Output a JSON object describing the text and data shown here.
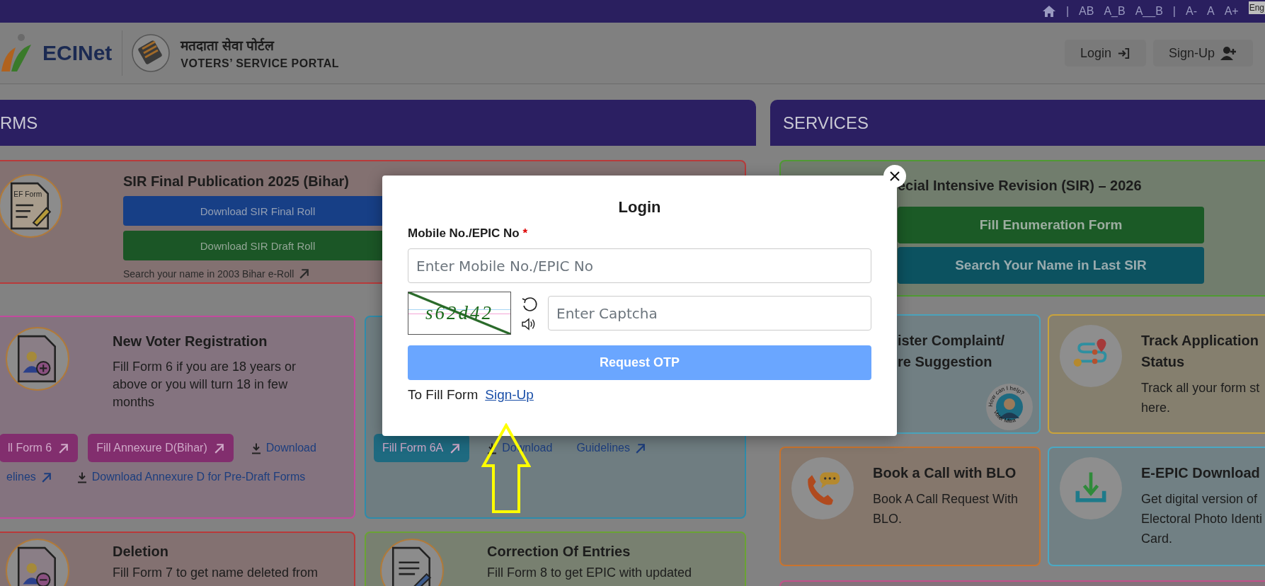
{
  "top_bar": {
    "separators": [
      "|",
      "|"
    ],
    "spacing_options": [
      "AB",
      "A_B",
      "A__B"
    ],
    "font_size_options": [
      "A-",
      "A",
      "A+"
    ],
    "language": "Eng"
  },
  "header": {
    "brand": "ECINet",
    "portal_title_hindi": "मतदाता सेवा पोर्टल",
    "portal_title": "VOTERS’ SERVICE PORTAL",
    "buttons": [
      {
        "label": "Login",
        "kind": "login"
      },
      {
        "label": "Sign-Up",
        "kind": "signup"
      }
    ]
  },
  "forms_panel": {
    "title": "RMS",
    "cards": [
      {
        "kind": "publication",
        "color": "#b83a3a",
        "icon_label": "EF Form",
        "title": "SIR Final Publication 2025 (Bihar)",
        "buttons": [
          {
            "label": "Download SIR Final Roll",
            "color": "#173f86"
          },
          {
            "label": "Download SIR Draft Roll",
            "color": "#1b5626"
          }
        ],
        "link": "Search your name in 2003 Bihar e-Roll"
      },
      {
        "kind": "form",
        "color": "#c24a9e",
        "title": "New Voter Registration",
        "description": [
          "Fill Form 6 if you are 18 years or",
          "above or you will turn 18 in few",
          "months"
        ],
        "action_rows": [
          [
            {
              "kind": "button",
              "label": "ll Form 6",
              "color": "#822e6e"
            },
            {
              "kind": "button",
              "label": "Fill Annexure D(Bihar)",
              "color": "#822e6e"
            },
            {
              "kind": "download",
              "label": "Download"
            }
          ],
          [
            {
              "kind": "link",
              "label": "elines"
            },
            {
              "kind": "download",
              "label": "Download Annexure D for Pre-Draft Forms"
            }
          ]
        ]
      },
      {
        "kind": "form",
        "color": "#2e8cab",
        "action_rows": [
          [
            {
              "kind": "button",
              "label": "Fill Form 6A",
              "color": "#1e6a80"
            },
            {
              "kind": "download",
              "label": "Download"
            },
            {
              "kind": "link",
              "label": "Guidelines"
            }
          ]
        ]
      },
      {
        "kind": "form",
        "color": "#b83a3a",
        "title": "Deletion",
        "description": [
          "Fill Form 7 to get name deleted from"
        ]
      },
      {
        "kind": "form",
        "color": "#6aa334",
        "title": "Correction Of Entries",
        "description": [
          "Fill Form 8 to get EPIC with updated"
        ]
      }
    ]
  },
  "services_panel": {
    "title": "SERVICES",
    "cards": [
      {
        "kind": "sir",
        "color": "#4f9a33",
        "title": [
          "ecial Intensive Revision (SIR) – 2026"
        ],
        "buttons": [
          {
            "label": "Fill Enumeration Form",
            "color": "#1b5a26"
          },
          {
            "label": "Search Your Name in Last SIR",
            "color": "#0c5260"
          }
        ]
      },
      {
        "kind": "service",
        "color": "#4aa3bc",
        "title": [
          "ister Complaint/",
          "re Suggestion"
        ],
        "badge": {
          "top": "How can I help?",
          "bottom": "Voter Mitra"
        }
      },
      {
        "kind": "service",
        "color": "#c9a33c",
        "title": [
          "Track Application",
          "Status"
        ],
        "description": [
          "Track all your form st",
          "here."
        ]
      },
      {
        "kind": "service",
        "color": "#c9742e",
        "title": [
          "Book a Call with BLO"
        ],
        "description": [
          "Book A Call Request With",
          "BLO."
        ]
      },
      {
        "kind": "service",
        "color": "#4aa8c4",
        "title": [
          "E-EPIC Download"
        ],
        "description": [
          "Get digital version of",
          "Electoral Photo Identi",
          "Card."
        ]
      },
      {
        "kind": "strip",
        "color": "#c2508a"
      }
    ]
  },
  "login_dialog": {
    "title": "Login",
    "field_label": "Mobile No./EPIC No",
    "required_mark": "*",
    "mobile_placeholder": "Enter Mobile No./EPIC No",
    "captcha_text": "s62d42",
    "captcha_placeholder": "Enter Captcha",
    "submit": "Request OTP",
    "signup_prompt": "To Fill Form",
    "signup_link": "Sign-Up"
  }
}
